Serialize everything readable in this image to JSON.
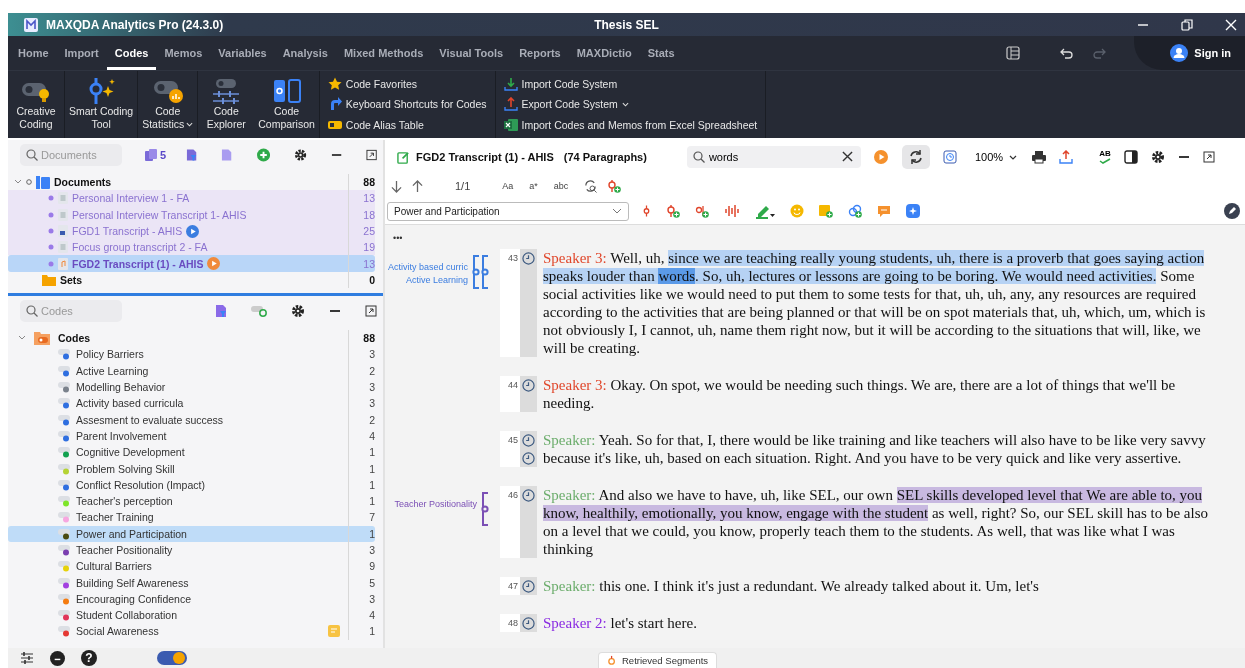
{
  "window": {
    "title": "MAXQDA Analytics Pro (24.3.0)",
    "project": "Thesis SEL"
  },
  "menu_tabs": [
    {
      "label": "Home",
      "selected": false
    },
    {
      "label": "Import",
      "selected": false
    },
    {
      "label": "Codes",
      "selected": true
    },
    {
      "label": "Memos",
      "selected": false
    },
    {
      "label": "Variables",
      "selected": false
    },
    {
      "label": "Analysis",
      "selected": false
    },
    {
      "label": "Mixed Methods",
      "selected": false
    },
    {
      "label": "Visual Tools",
      "selected": false
    },
    {
      "label": "Reports",
      "selected": false
    },
    {
      "label": "MAXDictio",
      "selected": false
    },
    {
      "label": "Stats",
      "selected": false
    }
  ],
  "account": {
    "label": "Sign in"
  },
  "ribbon": {
    "large_buttons": [
      {
        "kind": "creative",
        "lines": [
          "Creative",
          "Coding"
        ],
        "dropdown": false
      },
      {
        "kind": "smart",
        "lines": [
          "Smart Coding",
          "Tool"
        ],
        "dropdown": false
      },
      {
        "kind": "stats",
        "lines": [
          "Code",
          "Statistics"
        ],
        "dropdown": true
      },
      {
        "kind": "explorer",
        "lines": [
          "Code",
          "Explorer"
        ],
        "dropdown": false
      },
      {
        "kind": "comparison",
        "lines": [
          "Code",
          "Comparison"
        ],
        "dropdown": false
      }
    ],
    "small_columns": [
      [
        {
          "kind": "favorites",
          "label": "Code Favorites",
          "dropdown": false
        },
        {
          "kind": "shortcuts",
          "label": "Keyboard Shortcuts for Codes",
          "dropdown": false
        },
        {
          "kind": "alias",
          "label": "Code Alias Table",
          "dropdown": false
        }
      ],
      [
        {
          "kind": "import",
          "label": "Import Code System",
          "dropdown": false
        },
        {
          "kind": "export",
          "label": "Export Code System",
          "dropdown": true
        },
        {
          "kind": "excel",
          "label": "Import Codes and Memos from Excel Spreadsheet",
          "dropdown": false
        }
      ]
    ]
  },
  "documents_panel": {
    "search_placeholder": "Documents",
    "badge": "5",
    "root": {
      "label": "Documents",
      "count": "88",
      "expanded": true,
      "children": [
        {
          "label": "Personal Interview 1 - FA",
          "count": "13",
          "kind": "text",
          "activated": true,
          "selected": false
        },
        {
          "label": "Personal Interview Transcript 1- AHIS",
          "count": "18",
          "kind": "text",
          "activated": true,
          "selected": false
        },
        {
          "label": "FGD1 Transcript - AHIS",
          "count": "25",
          "kind": "video",
          "activated": true,
          "selected": false
        },
        {
          "label": "Focus group transcript 2 - FA",
          "count": "19",
          "kind": "text",
          "activated": true,
          "selected": false
        },
        {
          "label": "FGD2 Transcript (1) - AHIS",
          "count": "13",
          "kind": "audio",
          "activated": true,
          "selected": true
        }
      ]
    },
    "sets": {
      "label": "Sets",
      "count": "0"
    }
  },
  "codes_panel": {
    "search_placeholder": "Codes",
    "root": {
      "label": "Codes",
      "count": "88",
      "expanded": true,
      "children": [
        {
          "label": "Policy Barriers",
          "count": "3",
          "color": "#2f6fe0",
          "selected": false,
          "memo": false
        },
        {
          "label": "Active Learning",
          "count": "2",
          "color": "#2f6fe0",
          "selected": false,
          "memo": false
        },
        {
          "label": "Modelling Behavior",
          "count": "3",
          "color": "#7a828c",
          "selected": false,
          "memo": false
        },
        {
          "label": "Activity based curricula",
          "count": "3",
          "color": "#2f6fe0",
          "selected": false,
          "memo": false
        },
        {
          "label": "Assesment to evaluate success",
          "count": "2",
          "color": "#2f6fe0",
          "selected": false,
          "memo": false
        },
        {
          "label": "Parent Involvement",
          "count": "4",
          "color": "#2f6fe0",
          "selected": false,
          "memo": false
        },
        {
          "label": "Cognitive Development",
          "count": "1",
          "color": "#12a150",
          "selected": false,
          "memo": false
        },
        {
          "label": "Problem Solving Skill",
          "count": "1",
          "color": "#b5d334",
          "selected": false,
          "memo": false
        },
        {
          "label": "Conflict Resolution (Impact)",
          "count": "1",
          "color": "#2f6fe0",
          "selected": false,
          "memo": false
        },
        {
          "label": "Teacher's perception",
          "count": "1",
          "color": "#7ee52a",
          "selected": false,
          "memo": false
        },
        {
          "label": "Teacher Training",
          "count": "7",
          "color": "#f7a7e0",
          "selected": false,
          "memo": false
        },
        {
          "label": "Power and Participation",
          "count": "1",
          "color": "#4a4a10",
          "selected": true,
          "memo": false
        },
        {
          "label": "Teacher Positionality",
          "count": "3",
          "color": "#7b3fb0",
          "selected": false,
          "memo": false
        },
        {
          "label": "Cultural Barriers",
          "count": "9",
          "color": "#e6d20a",
          "selected": false,
          "memo": false
        },
        {
          "label": "Building Self Awareness",
          "count": "5",
          "color": "#a340e0",
          "selected": false,
          "memo": false
        },
        {
          "label": "Encouraging Confidence",
          "count": "3",
          "color": "#f57c10",
          "selected": false,
          "memo": false
        },
        {
          "label": "Student Collaboration",
          "count": "4",
          "color": "#e0355a",
          "selected": false,
          "memo": false
        },
        {
          "label": "Social Awareness",
          "count": "1",
          "color": "#e53935",
          "selected": false,
          "memo": true
        }
      ]
    }
  },
  "document_view": {
    "title": "FGD2 Transcript (1) - AHIS",
    "paragraph_count": "(74 Paragraphs)",
    "search_value": "words",
    "zoom": "100%",
    "spellcheck": "AB",
    "hit_index": "1/1",
    "text_options": [
      "Aa",
      "a*",
      "abc"
    ],
    "code_select": "Power and Participation",
    "more": "•••",
    "paragraphs": [
      {
        "number": "43",
        "timestamps": [
          {
            "kind": "clock"
          }
        ],
        "speaker": "Speaker 3:",
        "color": "#e0472b",
        "codes": [
          {
            "label": "Activity based curric",
            "color": "#3b7de0"
          },
          {
            "label": "Active Learning",
            "color": "#3b7de0"
          }
        ],
        "segments": [
          {
            "kind": "plain",
            "text": " Well, uh, "
          },
          {
            "kind": "coded",
            "color": "#b6d2f4",
            "text": "since we are teaching really young students, uh, there is a proverb that goes saying action speaks louder than "
          },
          {
            "kind": "search_hit",
            "text": "words"
          },
          {
            "kind": "coded",
            "color": "#b6d2f4",
            "text": ". So, uh, lectures or lessons are going to be boring. We would need activities."
          },
          {
            "kind": "plain",
            "text": " Some social activities like we would need to put them to some tests for that, uh, uh, any, any resources are required according to the activities that are being planned or that will be on spot materials that, uh, which, um, which is not obviously I, I cannot, uh, name them right now, but it will be according to the situations that will, like, we will be creating."
          }
        ]
      },
      {
        "number": "44",
        "timestamps": [
          {
            "kind": "clock"
          }
        ],
        "speaker": "Speaker 3:",
        "color": "#e0472b",
        "segments": [
          {
            "kind": "plain",
            "text": " Okay. On spot, we would be needing such things. We are, there are a lot of things that we'll be needing."
          }
        ]
      },
      {
        "number": "45",
        "timestamps": [
          {
            "kind": "clock"
          },
          {
            "kind": "clock"
          }
        ],
        "speaker": "Speaker:",
        "color": "#6cad6c",
        "segments": [
          {
            "kind": "plain",
            "text": " Yeah. So for that, I, there would be like training and like teachers will also have to be like very savvy because it's like, uh, based on each situation. Right. And you have to be very quick and like very assertive."
          }
        ]
      },
      {
        "number": "46",
        "timestamps": [
          {
            "kind": "clock"
          }
        ],
        "speaker": "Speaker:",
        "color": "#6cad6c",
        "codes": [
          {
            "label": "Teacher Positionality",
            "color": "#7b4fb5"
          }
        ],
        "segments": [
          {
            "kind": "plain",
            "text": " And also we have to have, uh, like SEL, our own "
          },
          {
            "kind": "coded",
            "color": "#c8b9e0",
            "text": "SEL skills developed level that We are able to, you know, healthily, emotionally, you know, engage with the student"
          },
          {
            "kind": "plain",
            "text": " as well, right? So, our SEL skill has to be also on a level that we could, you know, properly teach them to the students. As well, that was like what I was thinking"
          }
        ]
      },
      {
        "number": "47",
        "timestamps": [
          {
            "kind": "clock"
          }
        ],
        "speaker": "Speaker:",
        "color": "#6cad6c",
        "segments": [
          {
            "kind": "plain",
            "text": " this one. I think it's just a redundant. We already talked about it. Um, let's"
          }
        ]
      },
      {
        "number": "48",
        "timestamps": [
          {
            "kind": "clock"
          }
        ],
        "speaker": "Speaker 2:",
        "color": "#8a2be2",
        "segments": [
          {
            "kind": "plain",
            "text": " let's start here."
          }
        ]
      }
    ]
  },
  "bottom_bar": {
    "help": "?",
    "retrieved_tab": "Retrieved Segments"
  }
}
